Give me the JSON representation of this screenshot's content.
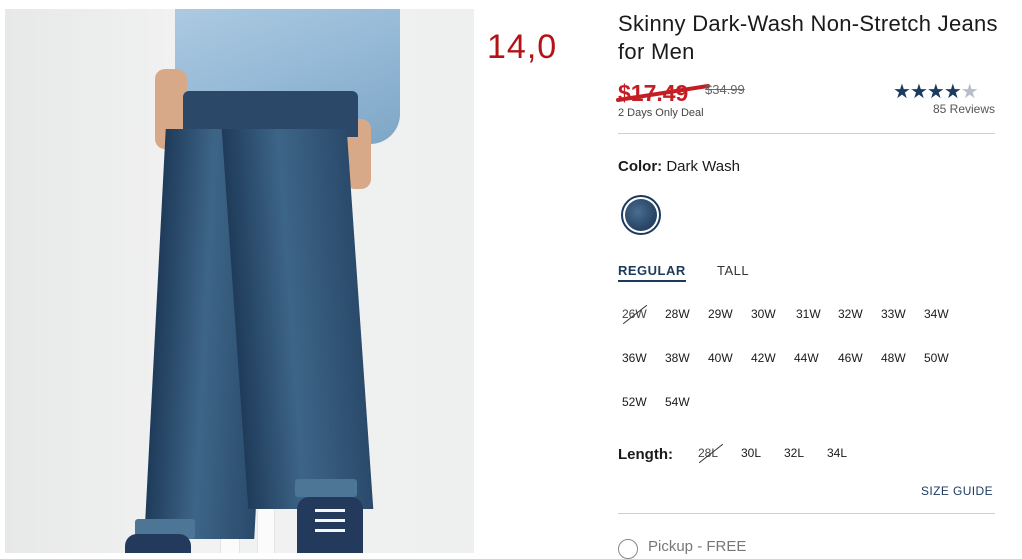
{
  "overlay": {
    "number": "14,0"
  },
  "product": {
    "title": "Skinny Dark-Wash Non-Stretch Jeans for Men",
    "sale_price": "$17.49",
    "original_price": "$34.99",
    "deal_note": "2 Days Only Deal",
    "rating": {
      "stars_filled": 4.5,
      "stars_total": 5,
      "reviews": "85 Reviews"
    }
  },
  "color": {
    "label": "Color:",
    "value": "Dark Wash",
    "swatch_color": "#2b4868"
  },
  "fit_tabs": [
    {
      "label": "REGULAR",
      "active": true
    },
    {
      "label": "TALL",
      "active": false
    }
  ],
  "waist_sizes": [
    {
      "label": "26W",
      "available": false
    },
    {
      "label": "28W",
      "available": true
    },
    {
      "label": "29W",
      "available": true
    },
    {
      "label": "30W",
      "available": true
    },
    {
      "label": "31W",
      "available": true
    },
    {
      "label": "32W",
      "available": true
    },
    {
      "label": "33W",
      "available": true
    },
    {
      "label": "34W",
      "available": true
    },
    {
      "label": "36W",
      "available": true
    },
    {
      "label": "38W",
      "available": true
    },
    {
      "label": "40W",
      "available": true
    },
    {
      "label": "42W",
      "available": true
    },
    {
      "label": "44W",
      "available": true
    },
    {
      "label": "46W",
      "available": true
    },
    {
      "label": "48W",
      "available": true
    },
    {
      "label": "50W",
      "available": true
    },
    {
      "label": "52W",
      "available": true
    },
    {
      "label": "54W",
      "available": true
    }
  ],
  "length": {
    "label": "Length:",
    "options": [
      {
        "label": "28L",
        "available": false
      },
      {
        "label": "30L",
        "available": true
      },
      {
        "label": "32L",
        "available": true
      },
      {
        "label": "34L",
        "available": true
      }
    ]
  },
  "size_guide": "SIZE GUIDE",
  "pickup": {
    "label": "Pickup - FREE"
  },
  "colors": {
    "accent": "#1b3a5e",
    "sale": "#c41e24",
    "overlay": "#b31217"
  }
}
